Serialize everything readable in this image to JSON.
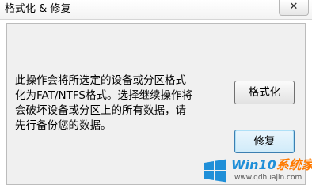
{
  "window": {
    "title": "格式化 & 修复",
    "close_glyph": "✕"
  },
  "message": {
    "lines": [
      "此操作会将所选定的设备或分区格式",
      "化为FAT/NTFS格式。选择继续操作将",
      "会破坏设备或分区上的所有数据，请",
      "先行备份您的数据。"
    ]
  },
  "buttons": {
    "format_label": "格式化",
    "repair_label": "修复"
  },
  "watermark": {
    "title_part1": "Win10",
    "title_part2": "系统家园",
    "url": "www.qdhuajin.com"
  },
  "colors": {
    "accent": "#1f8fd8",
    "watermark_orange": "#ff7a00"
  }
}
